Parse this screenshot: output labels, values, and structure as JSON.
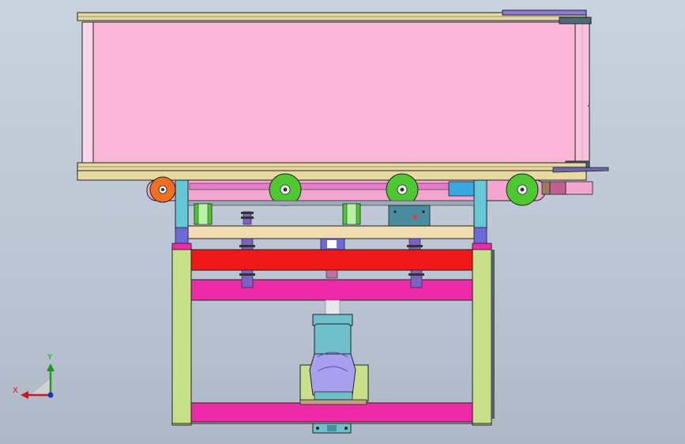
{
  "view": {
    "title": "",
    "background_top": "#c9d3df",
    "background_bottom": "#aeb8c7"
  },
  "triad": {
    "x_label": "X",
    "y_label": "Y",
    "x_color": "#d01818",
    "y_color": "#1a9a1a",
    "z_color": "#1a30d0"
  },
  "colors": {
    "belt": "#fbb6d8",
    "frame_wood": "#e8d9a0",
    "frame_post": "#c9e08a",
    "red_beam": "#f01818",
    "magenta_beam": "#ee2aa8",
    "motor_teal": "#6fc0cc",
    "motor_purple": "#a8a0ee",
    "cyan_post": "#64c8d6",
    "roller_orange": "#f07020",
    "roller_green": "#4ec830"
  }
}
